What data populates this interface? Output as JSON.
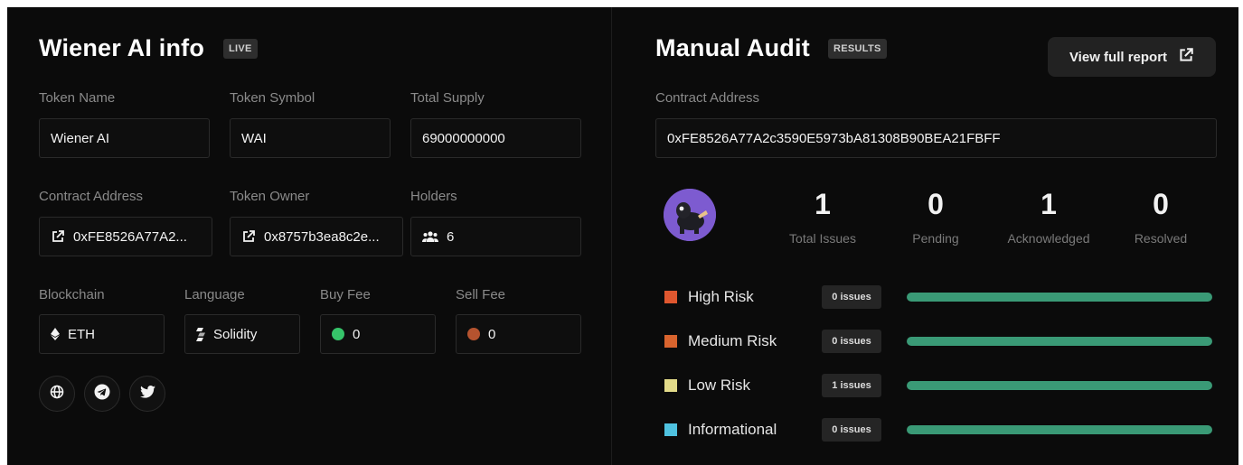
{
  "token_info": {
    "title": "Wiener AI info",
    "badge": "LIVE",
    "token_name": {
      "label": "Token Name",
      "value": "Wiener AI"
    },
    "token_symbol": {
      "label": "Token Symbol",
      "value": "WAI"
    },
    "total_supply": {
      "label": "Total Supply",
      "value": "69000000000"
    },
    "contract_address": {
      "label": "Contract Address",
      "value": "0xFE8526A77A2...",
      "icon": "external-link-icon"
    },
    "token_owner": {
      "label": "Token Owner",
      "value": "0x8757b3ea8c2e...",
      "icon": "external-link-icon"
    },
    "holders": {
      "label": "Holders",
      "value": "6",
      "icon": "users-icon"
    },
    "blockchain": {
      "label": "Blockchain",
      "value": "ETH",
      "icon": "ethereum-icon"
    },
    "language": {
      "label": "Language",
      "value": "Solidity",
      "icon": "solidity-icon"
    },
    "buy_fee": {
      "label": "Buy Fee",
      "value": "0",
      "color": "#36c46a"
    },
    "sell_fee": {
      "label": "Sell Fee",
      "value": "0",
      "color": "#b5532f"
    },
    "socials": [
      "globe-icon",
      "telegram-icon",
      "twitter-icon"
    ]
  },
  "audit": {
    "title": "Manual Audit",
    "badge": "RESULTS",
    "view_report_label": "View full report",
    "contract_address_label": "Contract Address",
    "contract_address": "0xFE8526A77A2c3590E5973bA81308B90BEA21FBFF",
    "stats": [
      {
        "value": "1",
        "label": "Total Issues"
      },
      {
        "value": "0",
        "label": "Pending"
      },
      {
        "value": "1",
        "label": "Acknowledged"
      },
      {
        "value": "0",
        "label": "Resolved"
      }
    ],
    "risks": [
      {
        "label": "High Risk",
        "issues": "0 issues",
        "color": "#e0572f",
        "progress": 1.0
      },
      {
        "label": "Medium Risk",
        "issues": "0 issues",
        "color": "#d9642e",
        "progress": 1.0
      },
      {
        "label": "Low Risk",
        "issues": "1 issues",
        "color": "#e3db8a",
        "progress": 1.0
      },
      {
        "label": "Informational",
        "issues": "0 issues",
        "color": "#4fc2e0",
        "progress": 1.0
      }
    ],
    "bar_color": "#3a9a76"
  }
}
